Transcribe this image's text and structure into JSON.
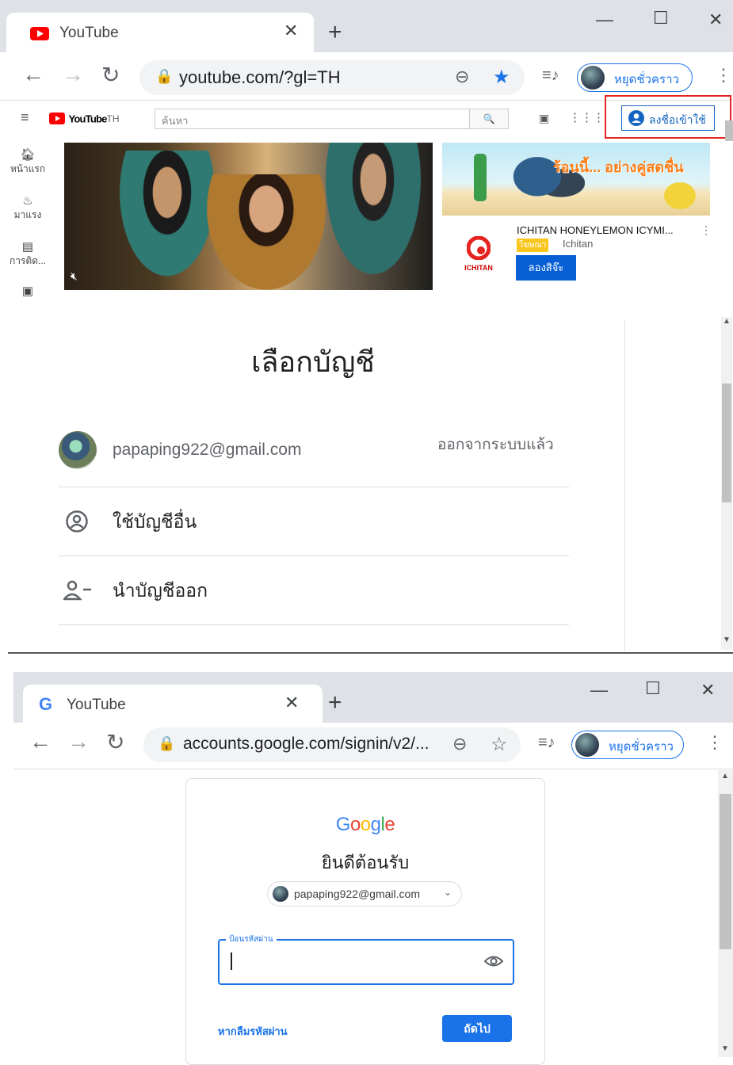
{
  "window1": {
    "tab_title": "YouTube",
    "url": "youtube.com/?gl=TH",
    "pause_label": "หยุดชั่วคราว"
  },
  "youtube": {
    "logo_text": "YouTube",
    "logo_suffix": "TH",
    "search_placeholder": "ค้นหา",
    "signin_label": "ลงชื่อเข้าใช้",
    "sidebar": [
      {
        "label": "หน้าแรก",
        "icon": "home-icon"
      },
      {
        "label": "มาแรง",
        "icon": "fire-icon"
      },
      {
        "label": "การติด...",
        "icon": "subscriptions-icon"
      },
      {
        "label": "",
        "icon": "library-icon"
      }
    ],
    "ad": {
      "title": "ICHITAN HONEYLEMON ICYMI...",
      "badge": "โฆษณา",
      "advertiser": "Ichitan",
      "brand": "ICHITAN",
      "cta": "ลองสิจ๊ะ",
      "banner_text": "ร้อนนี้... อย่างคู่สดชื่น"
    }
  },
  "chooser": {
    "title": "เลือกบัญชี",
    "accounts": [
      {
        "email": "papaping922@gmail.com",
        "status": "ออกจากระบบแล้ว"
      }
    ],
    "use_other": "ใช้บัญชีอื่น",
    "remove": "นำบัญชีออก"
  },
  "window2": {
    "tab_title": "YouTube",
    "url": "accounts.google.com/signin/v2/...",
    "pause_label": "หยุดชั่วคราว"
  },
  "signin": {
    "logo": "Google",
    "welcome": "ยินดีต้อนรับ",
    "email_chip": "papaping922@gmail.com",
    "password_label": "ป้อนรหัสผ่าน",
    "forgot": "หากลืมรหัสผ่าน",
    "next": "ถัดไป"
  },
  "colors": {
    "accent_blue": "#1a73e8",
    "youtube_red": "#ff0000",
    "highlight_red": "#e52420"
  }
}
